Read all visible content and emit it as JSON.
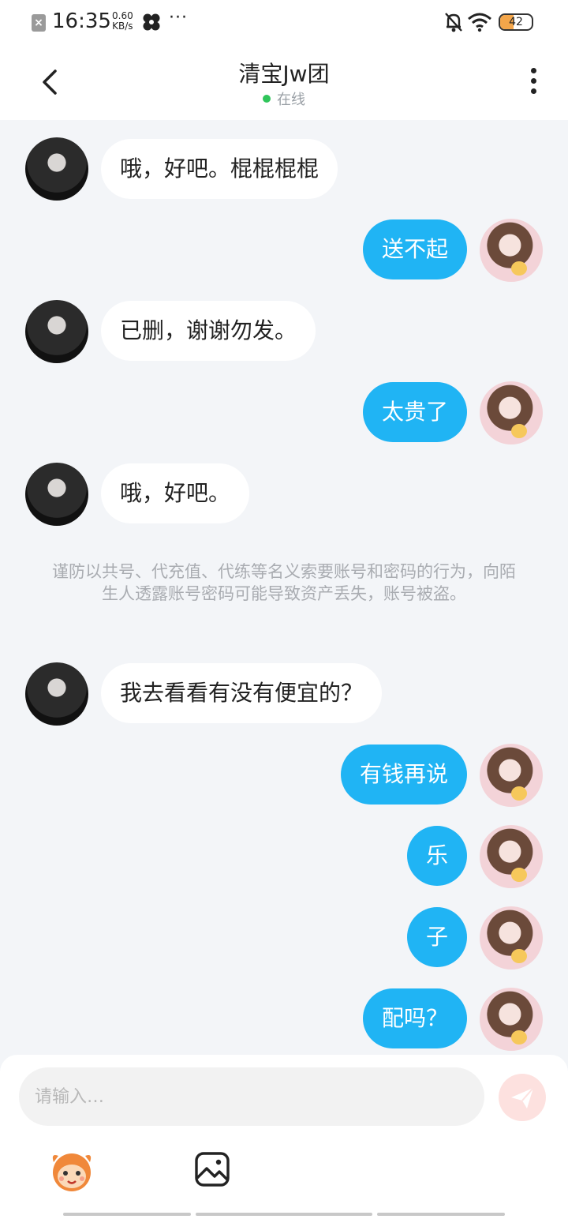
{
  "status_bar": {
    "time": "16:35",
    "speed_value": "0.60",
    "speed_unit": "KB/s",
    "battery": "42",
    "battery_level": 0.42
  },
  "header": {
    "title": "清宝Jw团",
    "status": "在线"
  },
  "messages": [
    {
      "side": "left",
      "text": "哦，好吧。棍棍棍棍"
    },
    {
      "side": "right",
      "text": "送不起"
    },
    {
      "side": "left",
      "text": "已删，谢谢勿发。"
    },
    {
      "side": "right",
      "text": "太贵了"
    },
    {
      "side": "left",
      "text": "哦，好吧。"
    },
    {
      "side": "left",
      "text": "我去看看有没有便宜的？"
    },
    {
      "side": "right",
      "text": "有钱再说"
    },
    {
      "side": "right",
      "text": "乐"
    },
    {
      "side": "right",
      "text": "子"
    },
    {
      "side": "right",
      "text": "配吗？"
    }
  ],
  "system_notice": "谨防以共号、代充值、代练等名义索要账号和密码的行为，向陌生人透露账号密码可能导致资产丢失，账号被盗。",
  "composer": {
    "placeholder": "请输入…"
  },
  "colors": {
    "accent": "#20b4f4",
    "online": "#2fc55a",
    "send_disabled": "#fde1df"
  }
}
